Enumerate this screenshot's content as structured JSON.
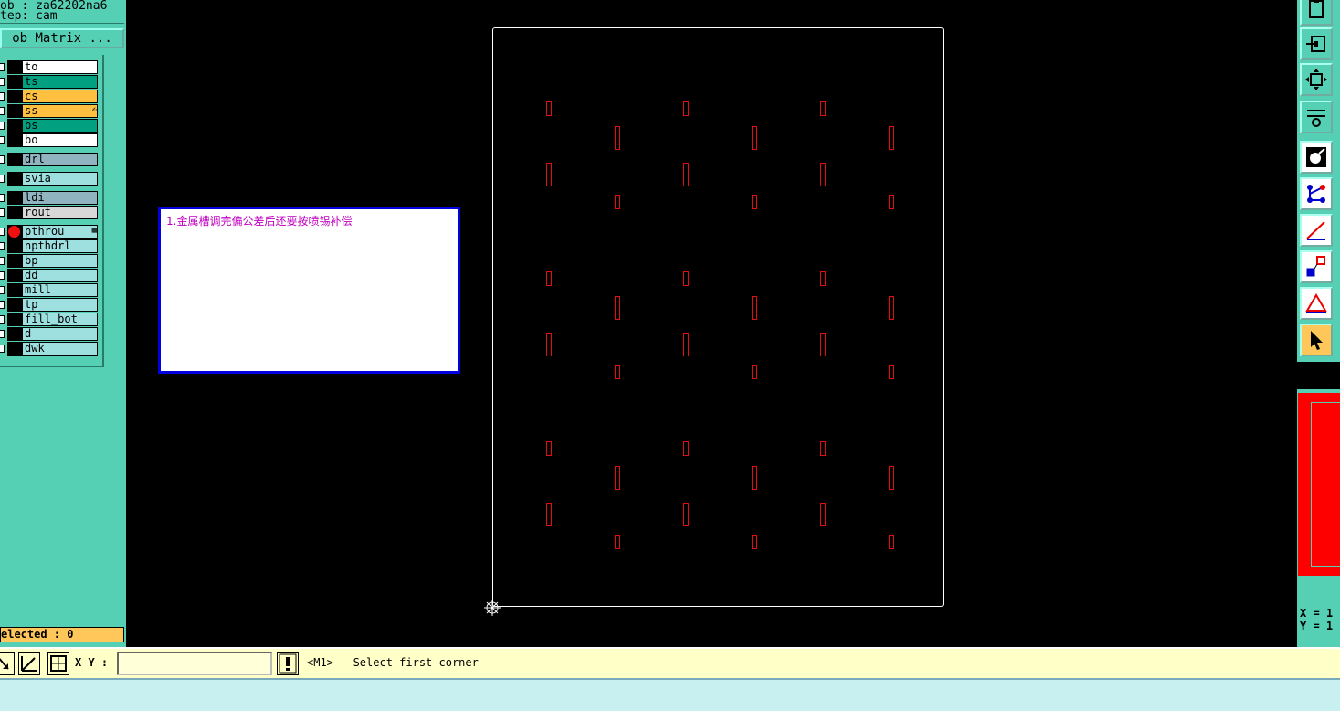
{
  "header": {
    "job_label": "ob : za62202na6",
    "step_label": "tep: cam",
    "job_matrix_button": "ob Matrix ..."
  },
  "layers": [
    {
      "name": "to",
      "color": "#ffffff"
    },
    {
      "name": "ts",
      "color": "#00a080"
    },
    {
      "name": "cs",
      "color": "#ffc040"
    },
    {
      "name": "ss",
      "color": "#ffc040",
      "marker": "✍"
    },
    {
      "name": "bs",
      "color": "#00a080"
    },
    {
      "name": "bo",
      "color": "#ffffff"
    },
    {
      "name": "drl",
      "color": "#90b4c0"
    },
    {
      "name": "svia",
      "color": "#9ee0e0"
    },
    {
      "name": "ldi",
      "color": "#90b4c0"
    },
    {
      "name": "rout",
      "color": "#d8d8d8"
    },
    {
      "name": "pthrou",
      "color": "#9ee0e0",
      "marker": "▦",
      "active": true
    },
    {
      "name": "npthdrl",
      "color": "#9ee0e0"
    },
    {
      "name": "bp",
      "color": "#9ee0e0"
    },
    {
      "name": "dd",
      "color": "#9ee0e0"
    },
    {
      "name": "mill",
      "color": "#9ee0e0"
    },
    {
      "name": "tp",
      "color": "#9ee0e0"
    },
    {
      "name": "fill_bot",
      "color": "#9ee0e0"
    },
    {
      "name": "d",
      "color": "#9ee0e0"
    },
    {
      "name": "dwk",
      "color": "#9ee0e0"
    }
  ],
  "selected_status": "elected : 0",
  "note": {
    "text": "1.金属槽调完偏公差后还要按喷锡补偿"
  },
  "right_toolbar": {
    "icons": [
      "clipboard-icon",
      "layer-move-icon",
      "fit-zoom-icon",
      "tools-icon",
      "feature-select-icon",
      "net-icon",
      "measure-icon",
      "snap-icon",
      "angle-icon",
      "pointer-icon"
    ]
  },
  "coords": {
    "x_label": "X = 1",
    "y_label": "Y = 1"
  },
  "command_bar": {
    "xy_label": "X Y :",
    "xy_value": "",
    "prompt": "<M1> - Select first corner"
  },
  "colors": {
    "panel": "#55d0b4",
    "slot": "#e01010",
    "note_text": "#c000c0"
  }
}
